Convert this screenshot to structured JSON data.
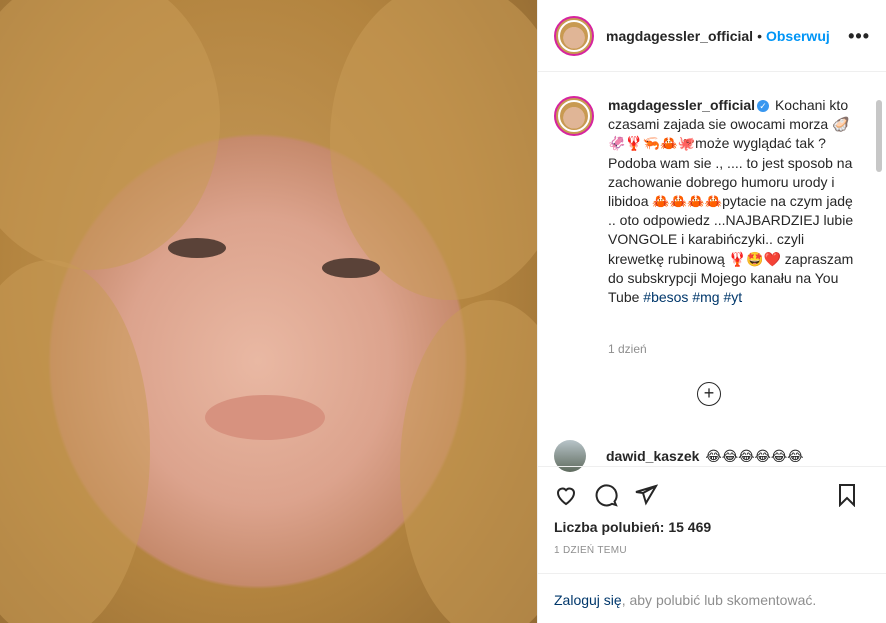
{
  "header": {
    "username": "magdagessler_official",
    "dot": "•",
    "follow_label": "Obserwuj",
    "more": "•••"
  },
  "caption": {
    "username": "magdagessler_official",
    "text": "Kochani kto czasami zajada sie owocami morza 🦪🦑🦞🦐🦀🐙może wyglądać tak ? Podoba wam sie ., .... to jest sposob na zachowanie dobrego humoru urody i libidoa 🦀🦀🦀🦀pytacie na czym jadę .. oto odpowiedz ...NAJBARDZIEJ lubie VONGOLE i karabińczyki.. czyli krewetkę rubinową 🦞🤩❤️ zapraszam do subskrypcji Mojego kanału na You Tube",
    "tags": "#besos #mg #yt",
    "time": "1 dzień"
  },
  "comment": {
    "username": "dawid_kaszek",
    "text": "😂😂😂😂😂😂"
  },
  "stats": {
    "likes": "Liczba polubień: 15 469",
    "posted": "1 DZIEŃ TEMU"
  },
  "login": {
    "link": "Zaloguj się",
    "rest": ", aby polubić lub skomentować."
  }
}
